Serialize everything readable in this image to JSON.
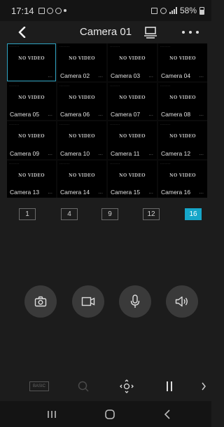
{
  "status_bar": {
    "time": "17:14",
    "battery": "58%"
  },
  "header": {
    "title": "Camera 01"
  },
  "grid": {
    "no_video_label": "NO VIDEO",
    "stamp": "--------",
    "ellipsis": "...",
    "cameras": [
      "",
      "Camera 02",
      "Camera 03",
      "Camera 04",
      "Camera 05",
      "Camera 06",
      "Camera 07",
      "Camera 08",
      "Camera 09",
      "Camera 10",
      "Camera 11",
      "Camera 12",
      "Camera 13",
      "Camera 14",
      "Camera 15",
      "Camera 16"
    ]
  },
  "split_options": [
    "1",
    "4",
    "9",
    "12",
    "16"
  ],
  "active_split": "16",
  "toolbar": {
    "basic_label": "BASIC"
  },
  "colors": {
    "accent": "#16a6c9",
    "background": "#1c1c1c"
  },
  "icons": {
    "back": "back-arrow-icon",
    "cast": "cast-icon",
    "more": "more-icon",
    "snapshot": "camera-icon",
    "record": "video-record-icon",
    "talk": "microphone-icon",
    "sound": "speaker-icon",
    "search": "search-icon",
    "ptz": "ptz-control-icon",
    "pause": "pause-icon",
    "next": "chevron-right-icon"
  }
}
